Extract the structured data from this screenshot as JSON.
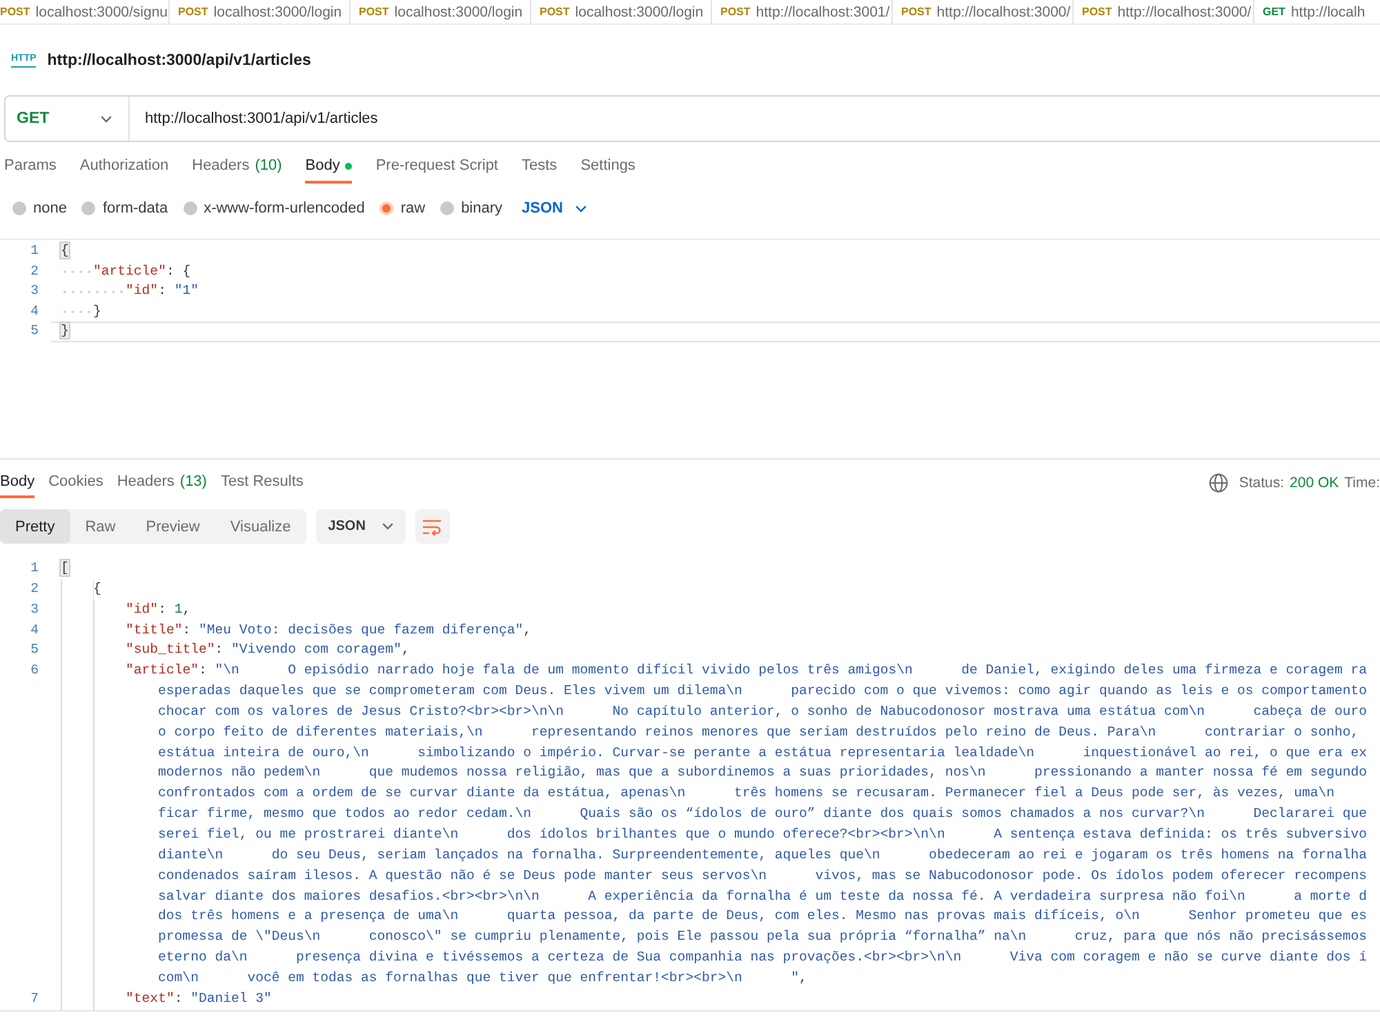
{
  "tabs": [
    {
      "method": "POST",
      "url": "localhost:3000/signu",
      "color": "#b48500"
    },
    {
      "method": "POST",
      "url": "localhost:3000/login",
      "color": "#b48500"
    },
    {
      "method": "POST",
      "url": "localhost:3000/login",
      "color": "#b48500"
    },
    {
      "method": "POST",
      "url": "localhost:3000/login",
      "color": "#b48500"
    },
    {
      "method": "POST",
      "url": "http://localhost:3001/",
      "color": "#b48500"
    },
    {
      "method": "POST",
      "url": "http://localhost:3000/",
      "color": "#b48500"
    },
    {
      "method": "POST",
      "url": "http://localhost:3000/",
      "color": "#b48500"
    },
    {
      "method": "GET",
      "url": "http://localh",
      "color": "#0f8a3c"
    }
  ],
  "request": {
    "badge": "HTTP",
    "title": "http://localhost:3000/api/v1/articles",
    "method": "GET",
    "url": "http://localhost:3001/api/v1/articles",
    "tabs": [
      {
        "label": "Params",
        "selected": false,
        "has_content": false
      },
      {
        "label": "Authorization",
        "selected": false,
        "has_content": false
      },
      {
        "label": "Headers",
        "count": "(10)",
        "selected": false,
        "has_content": false
      },
      {
        "label": "Body",
        "selected": true,
        "has_content": true
      },
      {
        "label": "Pre-request Script",
        "selected": false,
        "has_content": false
      },
      {
        "label": "Tests",
        "selected": false,
        "has_content": false
      },
      {
        "label": "Settings",
        "selected": false,
        "has_content": false
      }
    ],
    "body_types": [
      {
        "label": "none",
        "selected": false
      },
      {
        "label": "form-data",
        "selected": false
      },
      {
        "label": "x-www-form-urlencoded",
        "selected": false
      },
      {
        "label": "raw",
        "selected": true
      },
      {
        "label": "binary",
        "selected": false
      }
    ],
    "language": "JSON",
    "editor": {
      "lines": [
        {
          "number": "1",
          "active": false,
          "tokens": [
            {
              "kind": "match",
              "text": "{"
            }
          ]
        },
        {
          "number": "2",
          "active": false,
          "tokens": [
            {
              "kind": "key",
              "text": "    \"article\""
            },
            {
              "kind": "punct",
              "text": ": {"
            }
          ]
        },
        {
          "number": "3",
          "active": false,
          "tokens": [
            {
              "kind": "key",
              "text": "        \"id\""
            },
            {
              "kind": "punct",
              "text": ": "
            },
            {
              "kind": "string",
              "text": "\"1\""
            }
          ]
        },
        {
          "number": "4",
          "active": false,
          "tokens": [
            {
              "kind": "punct",
              "text": "    }"
            }
          ]
        },
        {
          "number": "5",
          "active": true,
          "tokens": [
            {
              "kind": "match",
              "text": "}"
            }
          ]
        }
      ]
    }
  },
  "response": {
    "tabs": [
      {
        "label": "Body",
        "selected": true
      },
      {
        "label": "Cookies",
        "selected": false
      },
      {
        "label": "Headers",
        "count": "(13)",
        "selected": false
      },
      {
        "label": "Test Results",
        "selected": false
      }
    ],
    "status_label": "Status:",
    "status": "200 OK",
    "time_label": "Time:",
    "views": [
      {
        "label": "Pretty",
        "selected": true
      },
      {
        "label": "Raw",
        "selected": false
      },
      {
        "label": "Preview",
        "selected": false
      },
      {
        "label": "Visualize",
        "selected": false
      }
    ],
    "language": "JSON",
    "wrap_lines": true,
    "editor": {
      "lines": [
        {
          "number": "1",
          "tokens": [
            {
              "kind": "match",
              "text": "["
            }
          ]
        },
        {
          "number": "2",
          "tokens": [
            {
              "kind": "punct",
              "text": "    {"
            }
          ]
        },
        {
          "number": "3",
          "tokens": [
            {
              "kind": "key",
              "text": "        \"id\""
            },
            {
              "kind": "punct",
              "text": ": "
            },
            {
              "kind": "number",
              "text": "1"
            },
            {
              "kind": "punct",
              "text": ","
            }
          ]
        },
        {
          "number": "4",
          "tokens": [
            {
              "kind": "key",
              "text": "        \"title\""
            },
            {
              "kind": "punct",
              "text": ": "
            },
            {
              "kind": "string",
              "text": "\"Meu Voto: decisões que fazem diferença\""
            },
            {
              "kind": "punct",
              "text": ","
            }
          ]
        },
        {
          "number": "5",
          "tokens": [
            {
              "kind": "key",
              "text": "        \"sub_title\""
            },
            {
              "kind": "punct",
              "text": ": "
            },
            {
              "kind": "string",
              "text": "\"Vivendo com coragem\""
            },
            {
              "kind": "punct",
              "text": ","
            }
          ]
        },
        {
          "number": "6",
          "tokens": [
            {
              "kind": "key",
              "text": "        \"article\""
            },
            {
              "kind": "punct",
              "text": ": "
            },
            {
              "kind": "string",
              "text": "\"\\n      O episódio narrado hoje fala de um momento difícil vivido pelos três amigos\\n      de Daniel, exigindo deles uma firmeza e coragem ra"
            }
          ],
          "wrapped": [
            [
              {
                "kind": "string",
                "text": "esperadas daqueles que se comprometeram com Deus. Eles vivem um dilema\\n      parecido com o que vivemos: como agir quando as leis e os comportamento"
              }
            ],
            [
              {
                "kind": "string",
                "text": "chocar com os valores de Jesus Cristo?<br><br>\\n\\n      No capítulo anterior, o sonho de Nabucodonosor mostrava uma estátua com\\n      cabeça de ouro"
              }
            ],
            [
              {
                "kind": "string",
                "text": "o corpo feito de diferentes materiais,\\n      representando reinos menores que seriam destruídos pelo reino de Deus. Para\\n      contrariar o sonho,"
              }
            ],
            [
              {
                "kind": "string",
                "text": "estátua inteira de ouro,\\n      simbolizando o império. Curvar-se perante a estátua representaria lealdade\\n      inquestionável ao rei, o que era ex"
              }
            ],
            [
              {
                "kind": "string",
                "text": "modernos não pedem\\n      que mudemos nossa religião, mas que a subordinemos a suas prioridades, nos\\n      pressionando a manter nossa fé em segundo"
              }
            ],
            [
              {
                "kind": "string",
                "text": "confrontados com a ordem de se curvar diante da estátua, apenas\\n      três homens se recusaram. Permanecer fiel a Deus pode ser, às vezes, uma\\n"
              }
            ],
            [
              {
                "kind": "string",
                "text": "ficar firme, mesmo que todos ao redor cedam.\\n      Quais são os “ídolos de ouro” diante dos quais somos chamados a nos curvar?\\n      Declararei que"
              }
            ],
            [
              {
                "kind": "string",
                "text": "serei fiel, ou me prostrarei diante\\n      dos ídolos brilhantes que o mundo oferece?<br><br>\\n\\n      A sentença estava definida: os três subversivo"
              }
            ],
            [
              {
                "kind": "string",
                "text": "diante\\n      do seu Deus, seriam lançados na fornalha. Surpreendentemente, aqueles que\\n      obedeceram ao rei e jogaram os três homens na fornalha"
              }
            ],
            [
              {
                "kind": "string",
                "text": "condenados saíram ilesos. A questão não é se Deus pode manter seus servos\\n      vivos, mas se Nabucodonosor pode. Os ídolos podem oferecer recompens"
              }
            ],
            [
              {
                "kind": "string",
                "text": "salvar diante dos maiores desafios.<br><br>\\n\\n      A experiência da fornalha é um teste da nossa fé. A verdadeira surpresa não foi\\n      a morte d"
              }
            ],
            [
              {
                "kind": "string",
                "text": "dos três homens e a presença de uma\\n      quarta pessoa, da parte de Deus, com eles. Mesmo nas provas mais difíceis, o\\n      Senhor prometeu que es"
              }
            ],
            [
              {
                "kind": "string",
                "text": "promessa de \\\"Deus\\n      conosco\\\" se cumpriu plenamente, pois Ele passou pela sua própria “fornalha” na\\n      cruz, para que nós não precisássemos"
              }
            ],
            [
              {
                "kind": "string",
                "text": "eterno da\\n      presença divina e tivéssemos a certeza de Sua companhia nas provações.<br><br>\\n\\n      Viva com coragem e não se curve diante dos í"
              }
            ],
            [
              {
                "kind": "string",
                "text": "com\\n      você em todas as fornalhas que tiver que enfrentar!<br><br>\\n      \""
              },
              {
                "kind": "punct",
                "text": ","
              }
            ]
          ]
        },
        {
          "number": "7",
          "tokens": [
            {
              "kind": "key",
              "text": "        \"text\""
            },
            {
              "kind": "punct",
              "text": ": "
            },
            {
              "kind": "string",
              "text": "\"Daniel 3\""
            }
          ]
        }
      ]
    }
  }
}
